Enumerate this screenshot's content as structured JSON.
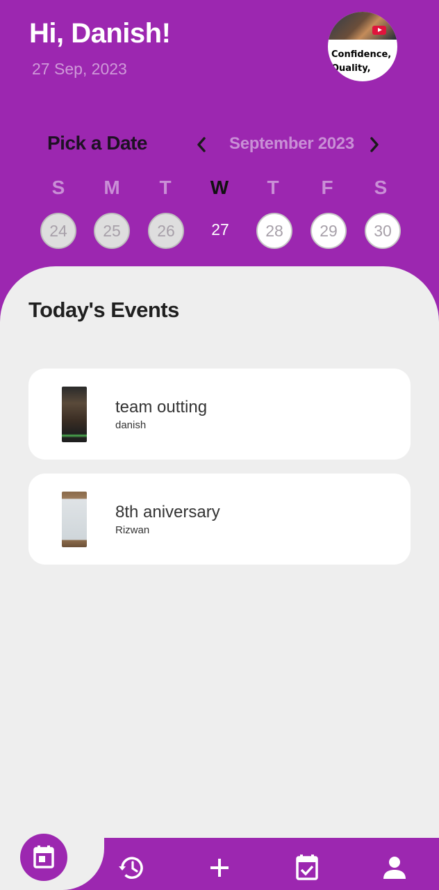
{
  "header": {
    "greeting": "Hi, Danish!",
    "date": "27 Sep, 2023",
    "avatar_text": "Confidence, Quality,"
  },
  "picker": {
    "label": "Pick a Date",
    "month": "September 2023",
    "prev_icon": "chevron-left-icon",
    "next_icon": "chevron-right-icon",
    "weekdays": [
      "S",
      "M",
      "T",
      "W",
      "T",
      "F",
      "S"
    ],
    "days": [
      "24",
      "25",
      "26",
      "27",
      "28",
      "29",
      "30"
    ],
    "selected_day": "27"
  },
  "events": {
    "title": "Today's Events",
    "items": [
      {
        "title": "team outting",
        "subtitle": "danish"
      },
      {
        "title": "8th aniversary",
        "subtitle": "Rizwan"
      }
    ]
  },
  "bottom_nav": {
    "items": [
      "calendar-icon",
      "history-icon",
      "add-icon",
      "event-available-icon",
      "person-icon"
    ]
  },
  "colors": {
    "primary": "#9c27b0",
    "background": "#eeeeee",
    "card": "#ffffff",
    "accent_text": "#c98fd6"
  }
}
